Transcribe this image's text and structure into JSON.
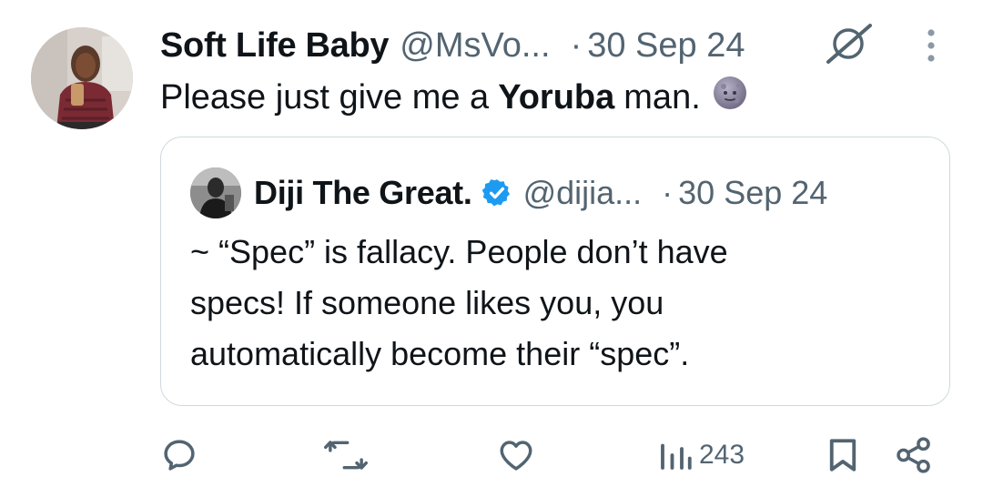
{
  "tweet": {
    "author_name": "Soft Life Baby",
    "author_handle": "@MsVo...",
    "separator": "·",
    "date": "30 Sep 24",
    "text_before": "Please just give me a",
    "text_bold": "Yoruba",
    "text_after": "man.",
    "emoji": "new-moon-face-emoji"
  },
  "quoted_tweet": {
    "author_name": "Diji The Great.",
    "verified": true,
    "author_handle": "@dijia...",
    "separator": "·",
    "date": "30 Sep 24",
    "lines": [
      "~ “Spec” is fallacy. People don’t have",
      "specs! If someone likes you, you",
      "automatically become their “spec”."
    ]
  },
  "actions": {
    "reply_icon": "reply-icon",
    "retweet_icon": "retweet-icon",
    "like_icon": "like-icon",
    "views_icon": "views-icon",
    "views_count": "243",
    "bookmark_icon": "bookmark-icon",
    "share_icon": "share-icon"
  },
  "colors": {
    "text": "#0f1419",
    "secondary": "#536471",
    "border": "#cfd9de",
    "verified": "#1d9bf0"
  }
}
